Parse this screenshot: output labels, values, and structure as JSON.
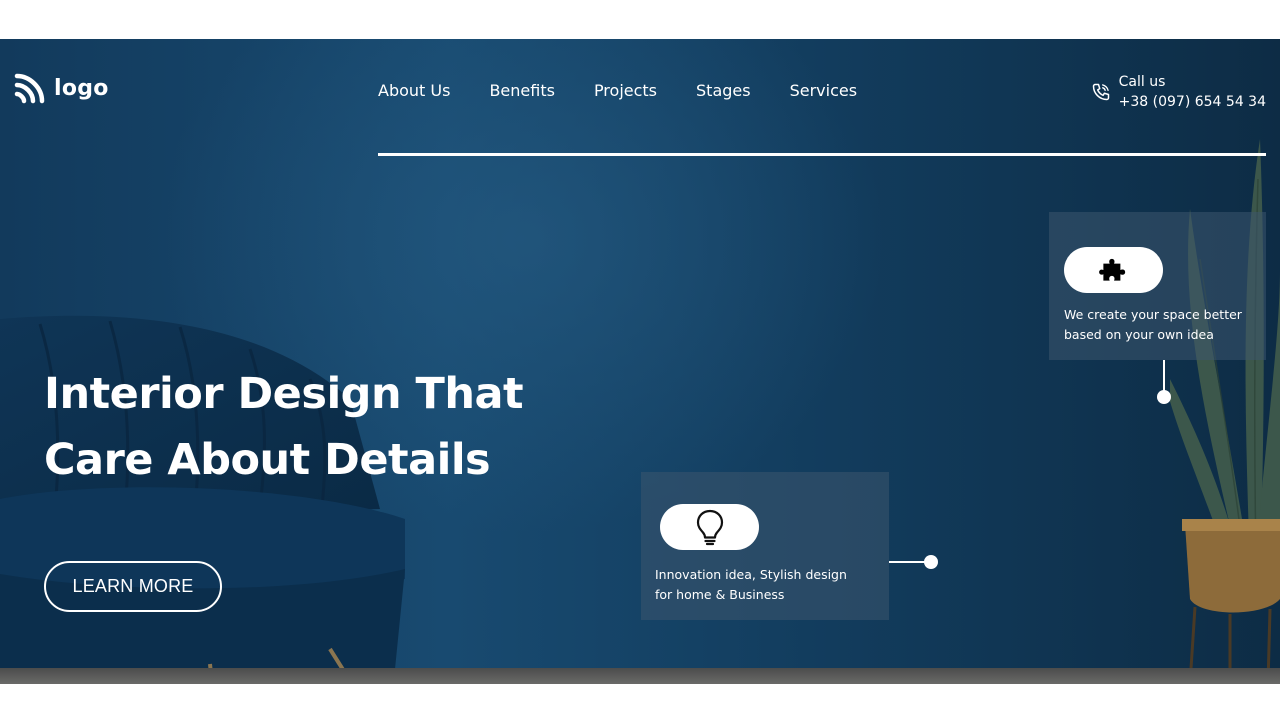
{
  "header": {
    "logo_text": "logo",
    "nav": [
      "About Us",
      "Benefits",
      "Projects",
      "Stages",
      "Services"
    ],
    "call_label": "Call us",
    "phone": "+38 (097) 654 54 34"
  },
  "hero": {
    "title_line1": "Interior Design That",
    "title_line2": "Care About Details",
    "cta_label": "LEARN MORE"
  },
  "cards": [
    {
      "icon": "puzzle-icon",
      "line1": "We create your space better",
      "line2": "based on your own idea"
    },
    {
      "icon": "lightbulb-icon",
      "line1": "Innovation idea, Stylish design",
      "line2": "for home & Business"
    }
  ],
  "colors": {
    "background": "#184a70",
    "text": "#ffffff",
    "card": "#3c556e"
  }
}
